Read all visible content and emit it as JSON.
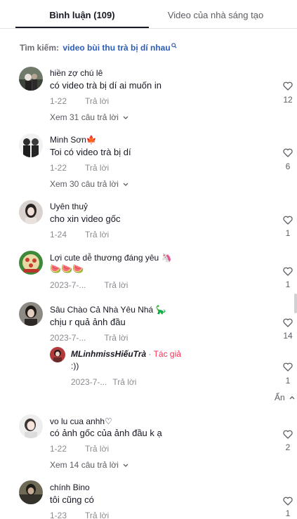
{
  "tabs": [
    {
      "label": "Bình luận (109)",
      "active": true
    },
    {
      "label": "Video của nhà sáng tạo",
      "active": false
    }
  ],
  "search": {
    "label": "Tìm kiếm:",
    "term": "video bùi thu trà bị dí nhau"
  },
  "comments": [
    {
      "user": "hiền zợ chú lê",
      "text": "có video trà bị dí ai muốn in",
      "date": "1-22",
      "reply_label": "Trả lời",
      "likes": "12",
      "view_replies": "Xem 31 câu trả lời"
    },
    {
      "user": "Minh Sơn🍁",
      "text": "Toi có video trà bị dí",
      "date": "1-22",
      "reply_label": "Trả lời",
      "likes": "6",
      "view_replies": "Xem 30 câu trả lời"
    },
    {
      "user": "Uyên thuỷ",
      "text": "cho xin video gốc",
      "date": "1-24",
      "reply_label": "Trả lời",
      "likes": "1"
    },
    {
      "user": "Lợi cute dễ thương đáng yêu 🦄",
      "text": "🍉🍉🍉",
      "date": "2023-7-...",
      "reply_label": "Trả lời",
      "likes": "1"
    },
    {
      "user": "Sâu Chào Cả Nhà Yêu Nhá 🦕",
      "text": "chịu r quả ảnh đầu",
      "date": "2023-7-...",
      "reply_label": "Trả lời",
      "likes": "14",
      "reply": {
        "user": "MLinhmissHiếuTrà",
        "author_tag": "· Tác giả",
        "text": ":))",
        "date": "2023-7-...",
        "reply_label": "Trả lời",
        "likes": "1"
      }
    },
    {
      "user": "vo lu cua anhh♡",
      "text": "có ảnh gốc của ảnh đầu k ạ",
      "date": "1-22",
      "reply_label": "Trả lời",
      "likes": "2",
      "view_replies": "Xem 14 câu trả lời"
    },
    {
      "user": "chính Bino",
      "text": "tôi cũng có",
      "date": "1-23",
      "reply_label": "Trả lời",
      "likes": "1"
    }
  ],
  "hide_label": "Ẩn",
  "colors": {
    "accent_link": "#2b5db9",
    "author_tag": "#fe2c55",
    "muted": "#8a8b91"
  },
  "icons": {
    "like": "heart-outline-icon",
    "expand": "chevron-down-icon",
    "collapse": "chevron-up-icon",
    "search": "search-icon"
  }
}
